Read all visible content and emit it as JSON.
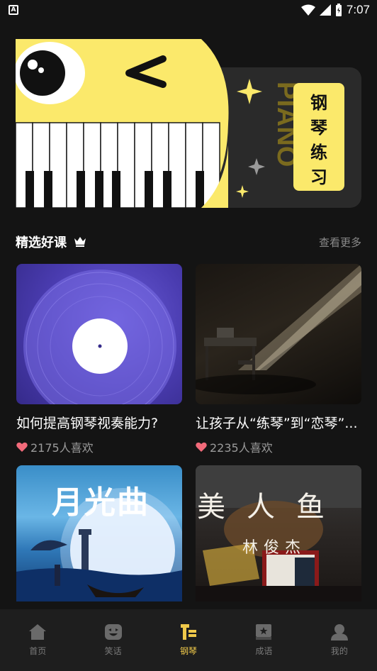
{
  "status_bar": {
    "time": "7:07"
  },
  "banner": {
    "title": "钢琴练习",
    "chars": [
      "钢",
      "琴",
      "练",
      "习"
    ],
    "piano_word": "PIANO"
  },
  "section": {
    "title": "精选好课",
    "more": "查看更多"
  },
  "courses": [
    {
      "title": "如何提高钢琴视奏能力?",
      "likes": "2175人喜欢"
    },
    {
      "title": "让孩子从“练琴”到“恋琴”...",
      "likes": "2235人喜欢"
    },
    {
      "cover_text": "月光曲"
    },
    {
      "cover_text": "美人鱼",
      "cover_sub": "林俊杰"
    }
  ],
  "tabs": [
    {
      "label": "首页",
      "icon": "home-icon"
    },
    {
      "label": "笑话",
      "icon": "smile-icon"
    },
    {
      "label": "钢琴",
      "icon": "piano-icon",
      "active": true
    },
    {
      "label": "成语",
      "icon": "book-icon"
    },
    {
      "label": "我的",
      "icon": "user-icon"
    }
  ],
  "colors": {
    "accent": "#f0c94a",
    "banner_yellow": "#fbe96b",
    "background": "#141414"
  }
}
